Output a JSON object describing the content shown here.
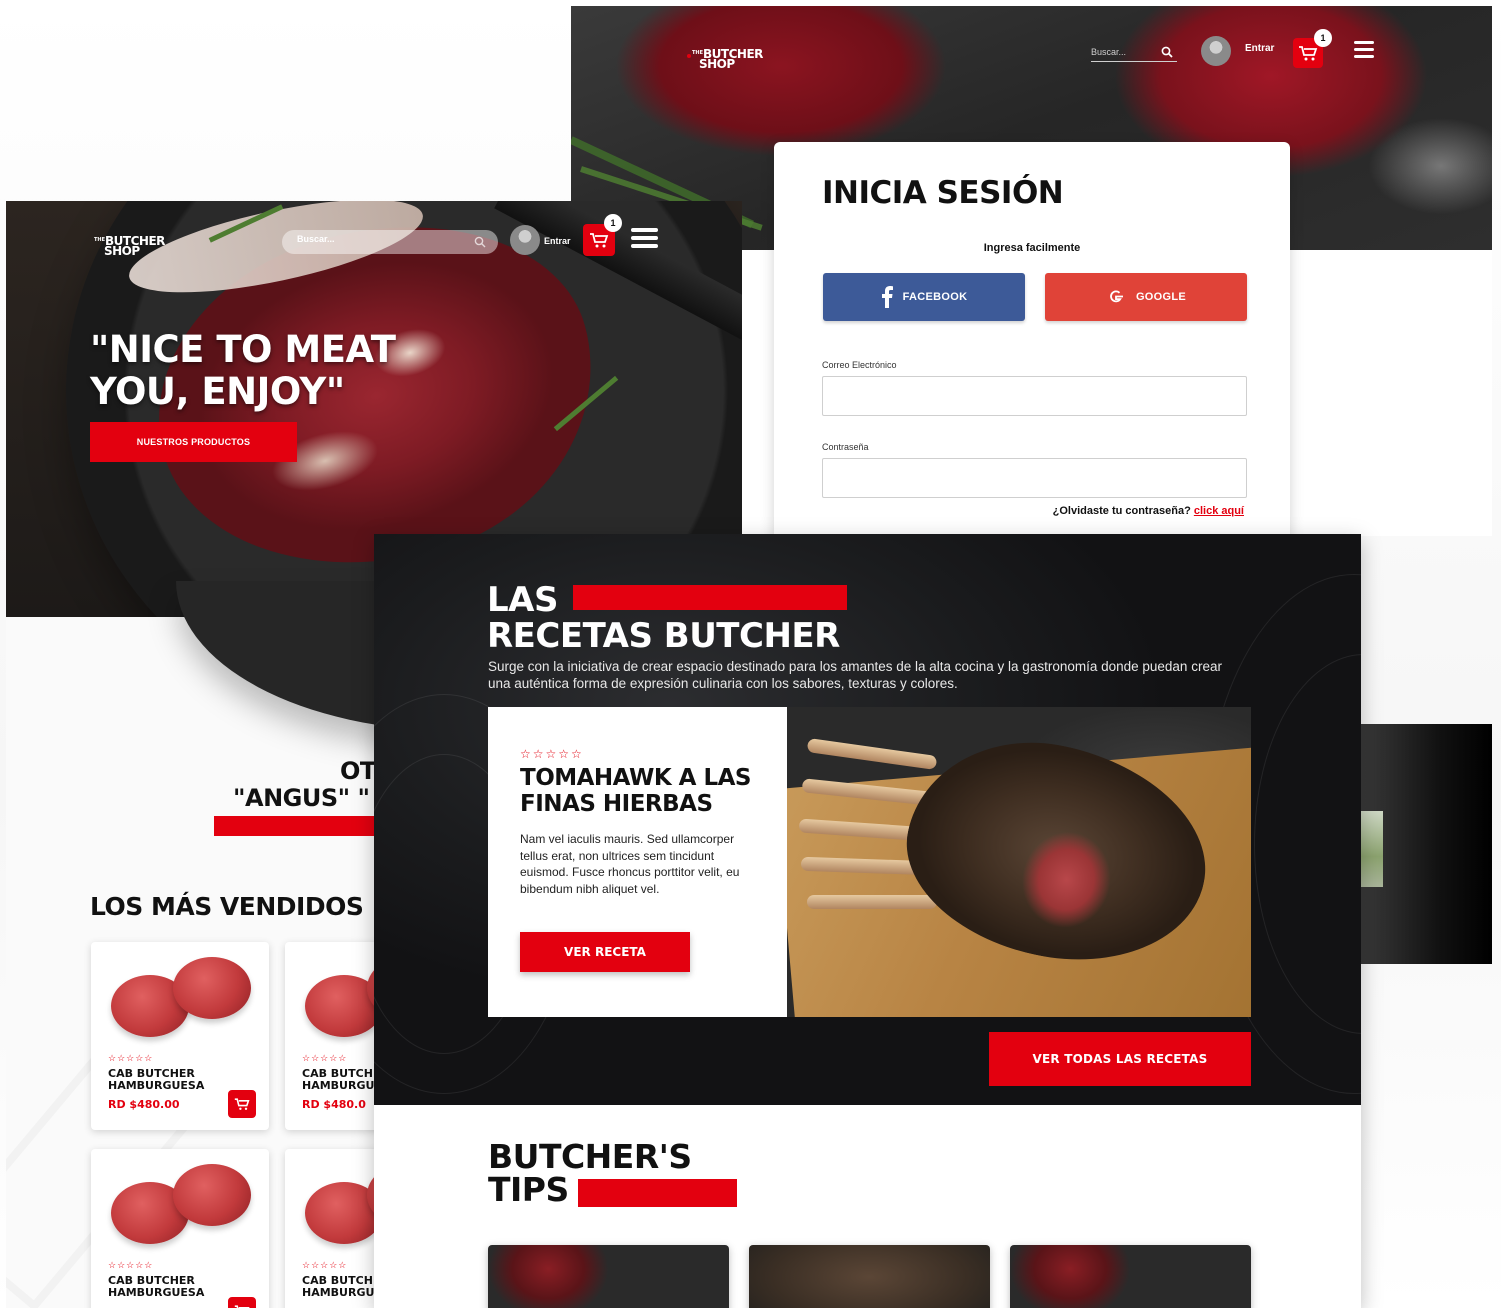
{
  "brand": {
    "the": "THE",
    "line1": "BUTCHER",
    "line2": "SHOP"
  },
  "header": {
    "search_placeholder": "Buscar...",
    "login_label": "Entrar",
    "cart_count": "1"
  },
  "login": {
    "title": "INICIA SESIÓN",
    "subtitle": "Ingresa facilmente",
    "facebook_label": "FACEBOOK",
    "google_label": "GOOGLE",
    "email_label": "Correo Electrónico",
    "email_value": "",
    "password_label": "Contraseña",
    "password_value": "",
    "forgot_text": "¿Olvidaste tu contraseña?",
    "forgot_link": "click aquí"
  },
  "home": {
    "tagline_line1": "\"NICE TO MEAT",
    "tagline_line2": "YOU, ENJOY\"",
    "cta_label": "NUESTROS PRODUCTOS",
    "angus_line1": "OT",
    "angus_line2": "\"ANGUS\" \"",
    "bestsellers_title": "LOS MÁS VENDIDOS",
    "products": [
      {
        "stars": "☆☆☆☆☆",
        "name_line1": "CAB BUTCHER",
        "name_line2": "HAMBURGUESA",
        "price": "RD $480.00"
      },
      {
        "stars": "☆☆☆☆☆",
        "name_line1": "CAB BUTCH",
        "name_line2": "HAMBURGU",
        "price": "RD $480.0"
      },
      {
        "stars": "☆☆☆☆☆",
        "name_line1": "CAB BUTCHER",
        "name_line2": "HAMBURGUESA",
        "price": ""
      },
      {
        "stars": "☆☆☆☆☆",
        "name_line1": "CAB BUTCH",
        "name_line2": "HAMBURGU",
        "price": ""
      }
    ]
  },
  "recipes": {
    "title_line1": "LAS",
    "title_line2": "RECETAS BUTCHER",
    "intro": "Surge con la iniciativa de crear espacio destinado para los amantes de la alta cocina y la gastronomía donde puedan crear una auténtica forma de expresión culinaria con los sabores, texturas y colores.",
    "featured": {
      "stars": "☆☆☆☆☆",
      "title_line1": "TOMAHAWK A LAS",
      "title_line2": "FINAS HIERBAS",
      "description": "Nam vel iaculis mauris. Sed ullamcorper tellus erat, non ultrices sem tincidunt euismod. Fusce rhoncus porttitor velit, eu bibendum nibh aliquet vel.",
      "button_label": "VER RECETA"
    },
    "all_button_label": "VER TODAS LAS RECETAS",
    "tips_title_line1": "BUTCHER'S",
    "tips_title_line2": "TIPS"
  },
  "colors": {
    "brand_red": "#e3000f",
    "facebook": "#3d5a98",
    "google": "#e04338",
    "dark": "#1b1c1e"
  }
}
